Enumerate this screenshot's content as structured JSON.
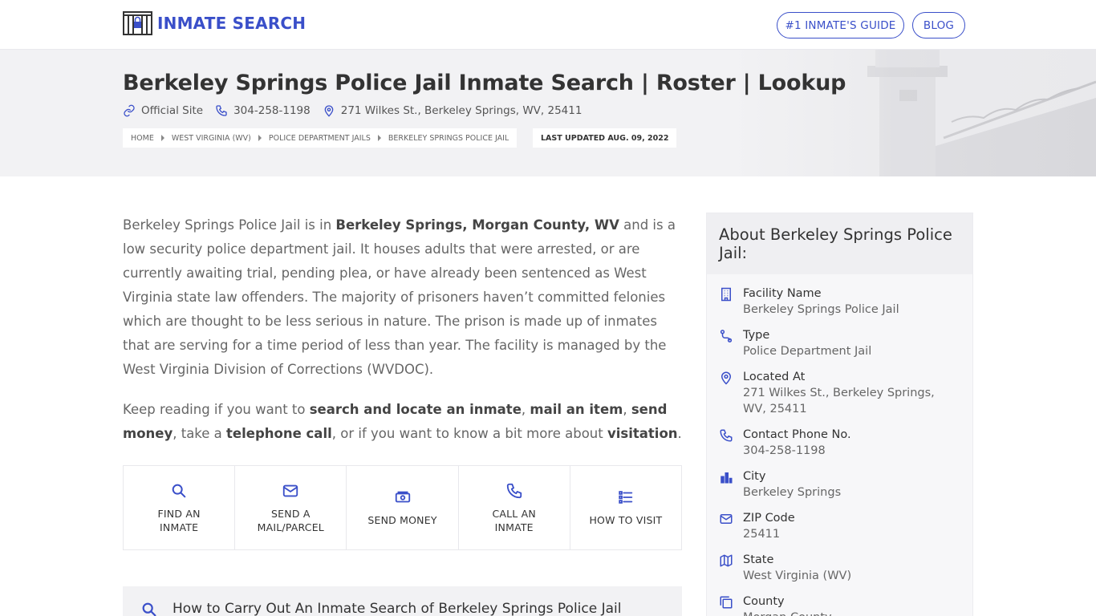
{
  "header": {
    "logo_text": "INMATE SEARCH",
    "nav": {
      "guide": "#1 INMATE'S GUIDE",
      "blog": "BLOG"
    }
  },
  "hero": {
    "title": "Berkeley Springs Police Jail Inmate Search | Roster | Lookup",
    "official_site": "Official Site",
    "phone": "304-258-1198",
    "address": "271 Wilkes St., Berkeley Springs, WV, 25411",
    "breadcrumbs": [
      "HOME",
      "WEST VIRGINIA (WV)",
      "POLICE DEPARTMENT JAILS",
      "BERKELEY SPRINGS POLICE JAIL"
    ],
    "last_updated": "LAST UPDATED AUG. 09, 2022"
  },
  "intro": {
    "p1": {
      "t1": "Berkeley Springs Police Jail is in ",
      "b1": "Berkeley Springs, Morgan County, WV",
      "t2": " and is a low security police department jail. It houses adults that were arrested, or are currently awaiting trial, pending plea, or have already been sentenced as West Virginia state law offenders. The majority of prisoners haven’t committed felonies which are thought to be less serious in nature. The prison is made up of inmates that are serving for a time period of less than year. The facility is managed by the West Virginia Division of Corrections (WVDOC)."
    },
    "p2": {
      "t1": "Keep reading if you want to ",
      "b1": "search and locate an inmate",
      "t2": ", ",
      "b2": "mail an item",
      "t3": ", ",
      "b3": "send money",
      "t4": ", take a ",
      "b4": "telephone call",
      "t5": ", or if you want to know a bit more about ",
      "b5": "visitation",
      "t6": "."
    }
  },
  "actions": [
    {
      "line1": "FIND AN",
      "line2": "INMATE",
      "icon": "search-icon"
    },
    {
      "line1": "SEND A",
      "line2": "MAIL/PARCEL",
      "icon": "mail-icon"
    },
    {
      "line1": "SEND MONEY",
      "line2": "",
      "icon": "money-icon"
    },
    {
      "line1": "CALL AN",
      "line2": "INMATE",
      "icon": "phone-icon"
    },
    {
      "line1": "HOW TO VISIT",
      "line2": "",
      "icon": "list-icon"
    }
  ],
  "howto": {
    "title": "How to Carry Out An Inmate Search of Berkeley Springs Police Jail"
  },
  "sidebar": {
    "title": "About Berkeley Springs Police Jail:",
    "items": [
      {
        "label": "Facility Name",
        "value": "Berkeley Springs Police Jail",
        "icon": "building-icon"
      },
      {
        "label": "Type",
        "value": "Police Department Jail",
        "icon": "route-icon"
      },
      {
        "label": "Located At",
        "value": "271 Wilkes St., Berkeley Springs, WV, 25411",
        "icon": "map-pin-icon"
      },
      {
        "label": "Contact Phone No.",
        "value": "304-258-1198",
        "icon": "phone-icon"
      },
      {
        "label": "City",
        "value": "Berkeley Springs",
        "icon": "city-icon"
      },
      {
        "label": "ZIP Code",
        "value": "25411",
        "icon": "mail-icon"
      },
      {
        "label": "State",
        "value": "West Virginia (WV)",
        "icon": "map-icon"
      },
      {
        "label": "County",
        "value": "Morgan County",
        "icon": "copy-icon"
      }
    ]
  },
  "colors": {
    "accent": "#3a4fc9",
    "hero_bg": "#f2f2f4"
  }
}
